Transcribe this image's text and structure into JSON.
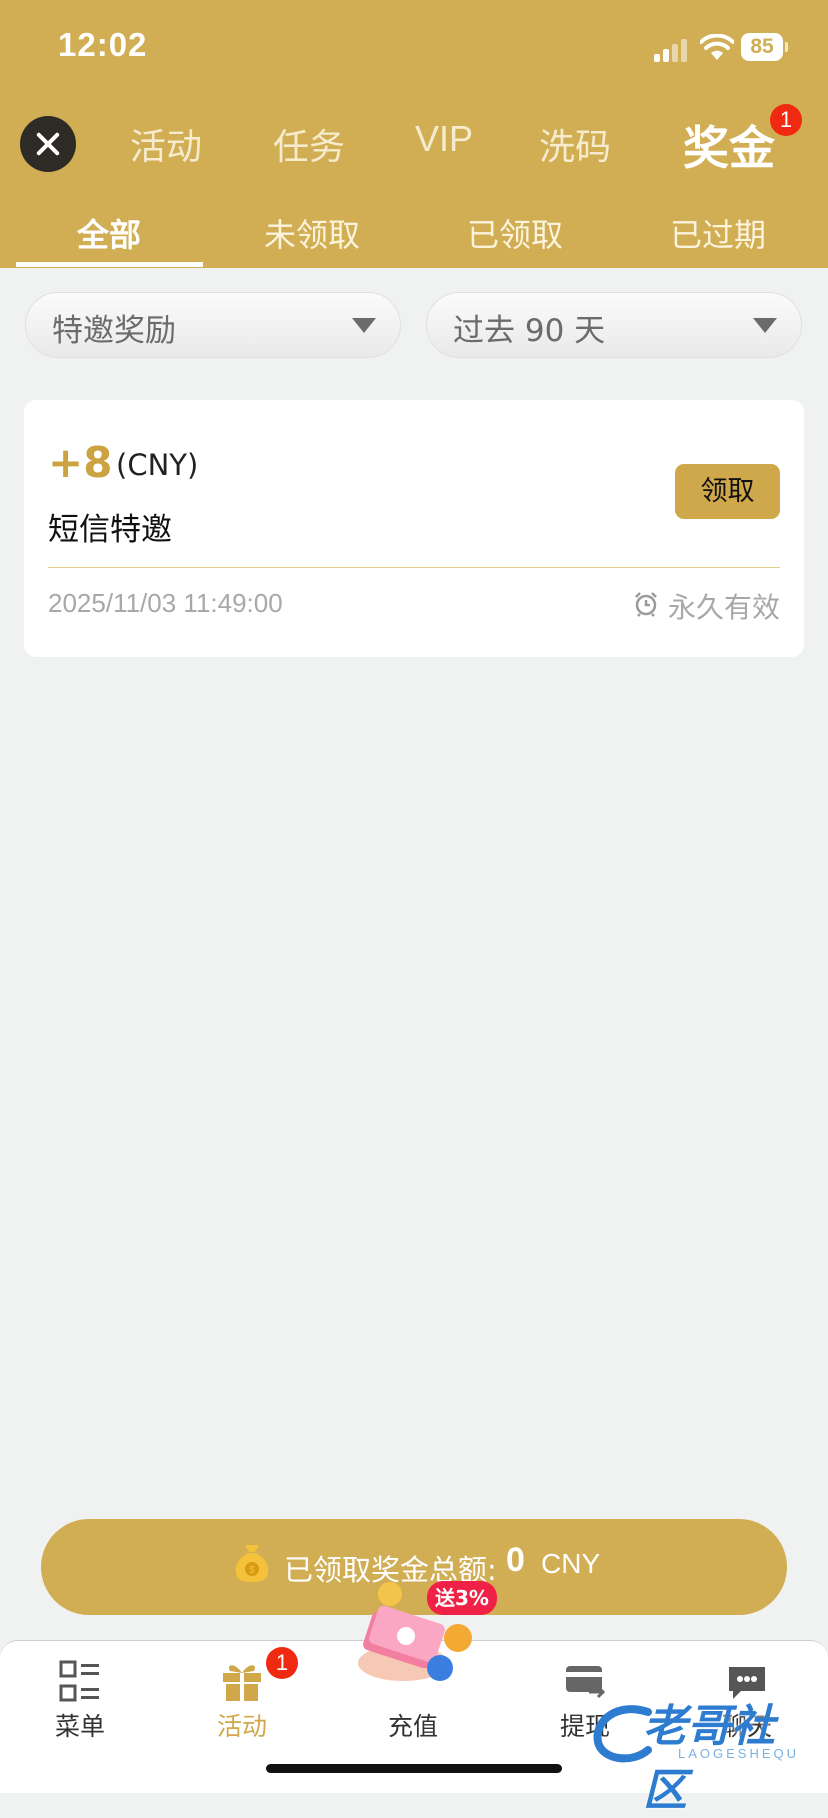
{
  "status_bar": {
    "time": "12:02",
    "battery": "85"
  },
  "header": {
    "tabs": [
      {
        "label": "活动"
      },
      {
        "label": "任务"
      },
      {
        "label": "VIP"
      },
      {
        "label": "洗码"
      },
      {
        "label": "奖金",
        "active": true,
        "badge": "1"
      }
    ],
    "sub_tabs": [
      {
        "label": "全部",
        "active": true
      },
      {
        "label": "未领取"
      },
      {
        "label": "已领取"
      },
      {
        "label": "已过期"
      }
    ]
  },
  "filters": {
    "type": {
      "value": "特邀奖励"
    },
    "period": {
      "value": "过去 90 天"
    }
  },
  "rewards": [
    {
      "amount": "+8",
      "currency": "(CNY)",
      "title": "短信特邀",
      "button": "领取",
      "datetime": "2025/11/03 11:49:00",
      "validity": "永久有效"
    }
  ],
  "summary": {
    "label": "已领取奖金总额:",
    "value": "0",
    "unit": "CNY"
  },
  "tab_bar": {
    "items": [
      {
        "label": "菜单",
        "icon": "menu-grid-icon"
      },
      {
        "label": "活动",
        "icon": "gift-icon",
        "active": true,
        "badge": "1"
      },
      {
        "label": "充值",
        "icon": "recharge-icon",
        "tag": "送3%"
      },
      {
        "label": "提现",
        "icon": "card-withdraw-icon"
      },
      {
        "label": "聊天",
        "icon": "chat-icon"
      }
    ]
  },
  "watermark": {
    "text": "老哥社区",
    "sub": "LAOGESHEQU"
  },
  "colors": {
    "brand_gold": "#d1ae54",
    "badge_red": "#f02a10",
    "tag_red": "#ef2146"
  }
}
